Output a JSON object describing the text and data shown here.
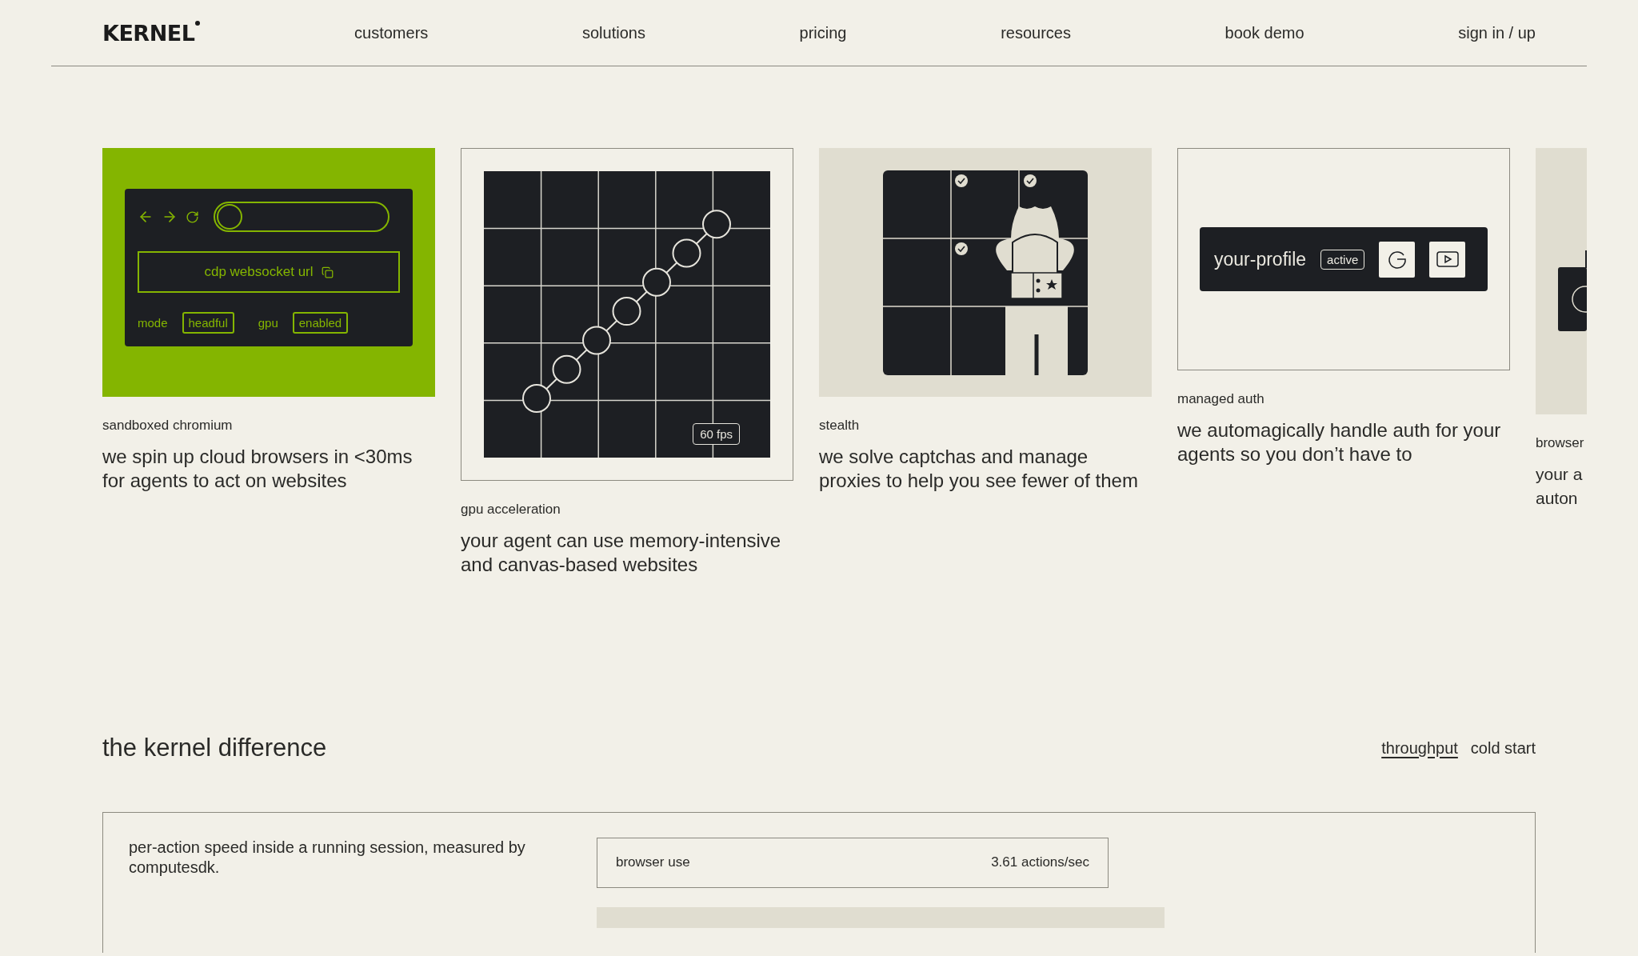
{
  "header": {
    "logo": "KERNEL",
    "nav": [
      "customers",
      "solutions",
      "pricing",
      "resources",
      "book demo",
      "sign in / up"
    ]
  },
  "features": [
    {
      "kind": "browser",
      "caption": "sandboxed chromium",
      "description": [
        "we spin up cloud browsers in <30ms",
        "for agents to act on websites"
      ],
      "button": "cdp websocket url",
      "settings": [
        {
          "label": "mode",
          "value": "headful"
        },
        {
          "label": "gpu",
          "value": "enabled"
        }
      ]
    },
    {
      "kind": "gpu",
      "caption": "gpu acceleration",
      "description": [
        "your agent can use memory-intensive",
        "and canvas-based websites"
      ],
      "badge": "60 fps"
    },
    {
      "kind": "stealth",
      "caption": "stealth",
      "description": [
        "we solve captchas and manage",
        "proxies to help you see fewer of them"
      ]
    },
    {
      "kind": "auth",
      "caption": "managed auth",
      "description": [
        "we automagically handle auth for your",
        "agents so you don’t have to"
      ],
      "profile": "your-profile",
      "status": "active"
    },
    {
      "kind": "partial",
      "caption": "browser",
      "description": [
        "your a",
        "auton"
      ]
    }
  ],
  "difference": {
    "title": "the kernel difference",
    "tabs": [
      {
        "label": "throughput",
        "selected": true
      },
      {
        "label": "cold start",
        "selected": false
      }
    ],
    "note": "per-action speed inside a running session, measured by computesdk.",
    "metrics": [
      {
        "name": "browser use",
        "value": "3.61 actions/sec"
      }
    ]
  }
}
